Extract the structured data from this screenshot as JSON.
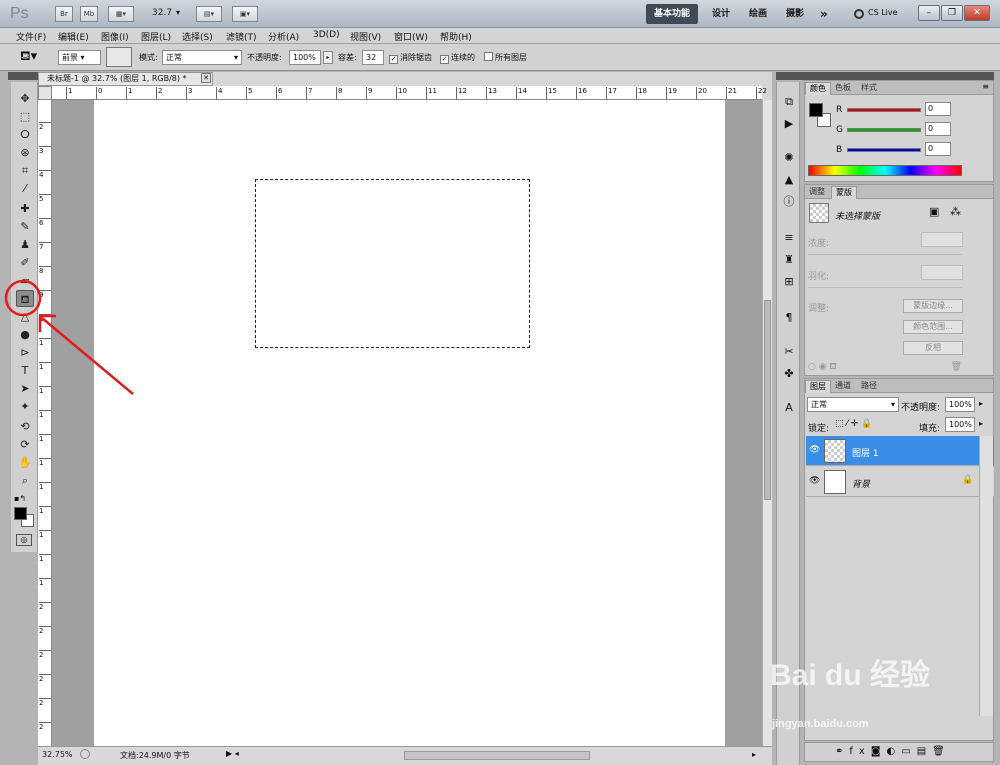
{
  "app": {
    "logo": "Ps",
    "br_label": "Br",
    "mb_label": "Mb",
    "zoom_level": "32.7",
    "workspaces": [
      "基本功能",
      "设计",
      "绘画",
      "摄影"
    ],
    "more_label": "»",
    "cslive_label": "CS Live"
  },
  "menu": [
    "文件(F)",
    "编辑(E)",
    "图像(I)",
    "图层(L)",
    "选择(S)",
    "滤镜(T)",
    "分析(A)",
    "3D(D)",
    "视图(V)",
    "窗口(W)",
    "帮助(H)"
  ],
  "options": {
    "fill_source": "前景",
    "mode_label": "模式:",
    "mode_value": "正常",
    "opacity_label": "不透明度:",
    "opacity_value": "100%",
    "tolerance_label": "容差:",
    "tolerance_value": "32",
    "antialias_label": "消除锯齿",
    "contiguous_label": "连续的",
    "all_layers_label": "所有图层"
  },
  "document": {
    "tab_title": "未标题-1 @ 32.7% (图层 1, RGB/8) *",
    "ruler_h_ticks": [
      "1",
      "0",
      "1",
      "2",
      "3",
      "4",
      "5",
      "6",
      "7",
      "8",
      "9",
      "10",
      "11",
      "12",
      "13",
      "14",
      "15",
      "16",
      "17",
      "18",
      "19",
      "20",
      "21",
      "22"
    ],
    "ruler_v_ticks": [
      "2",
      "3",
      "4",
      "5",
      "6",
      "7",
      "8",
      "9",
      "1",
      "1",
      "1",
      "1",
      "1",
      "1",
      "1",
      "1",
      "1",
      "1",
      "1",
      "1",
      "2",
      "2",
      "2",
      "2",
      "2",
      "2"
    ],
    "status_zoom": "32.75%",
    "status_doc": "文档:24.9M/0 字节"
  },
  "color_panel": {
    "tabs": [
      "颜色",
      "色板",
      "样式"
    ],
    "channels": [
      {
        "name": "R",
        "value": "0",
        "color": "#d40000"
      },
      {
        "name": "G",
        "value": "0",
        "color": "#00b000"
      },
      {
        "name": "B",
        "value": "0",
        "color": "#0000d0"
      }
    ]
  },
  "masks_panel": {
    "tabs": [
      "调整",
      "蒙版"
    ],
    "no_mask_label": "未选择蒙版",
    "density_label": "浓度:",
    "feather_label": "羽化:",
    "refine_label": "调整:",
    "mask_edge_button": "蒙版边缘...",
    "color_range_button": "颜色范围...",
    "invert_button": "反相"
  },
  "layers_panel": {
    "tabs": [
      "图层",
      "通道",
      "路径"
    ],
    "blend_mode": "正常",
    "opacity_label": "不透明度:",
    "opacity_value": "100%",
    "lock_label": "锁定:",
    "fill_label": "填充:",
    "fill_value": "100%",
    "layers": [
      {
        "name": "图层 1",
        "selected": true
      },
      {
        "name": "背景",
        "selected": false
      }
    ]
  },
  "watermark": {
    "brand": "Bai du 经验",
    "url": "jingyan.baidu.com"
  },
  "colors": {
    "annotation": "#e31b1b",
    "selected_layer": "#3a8ee6"
  }
}
